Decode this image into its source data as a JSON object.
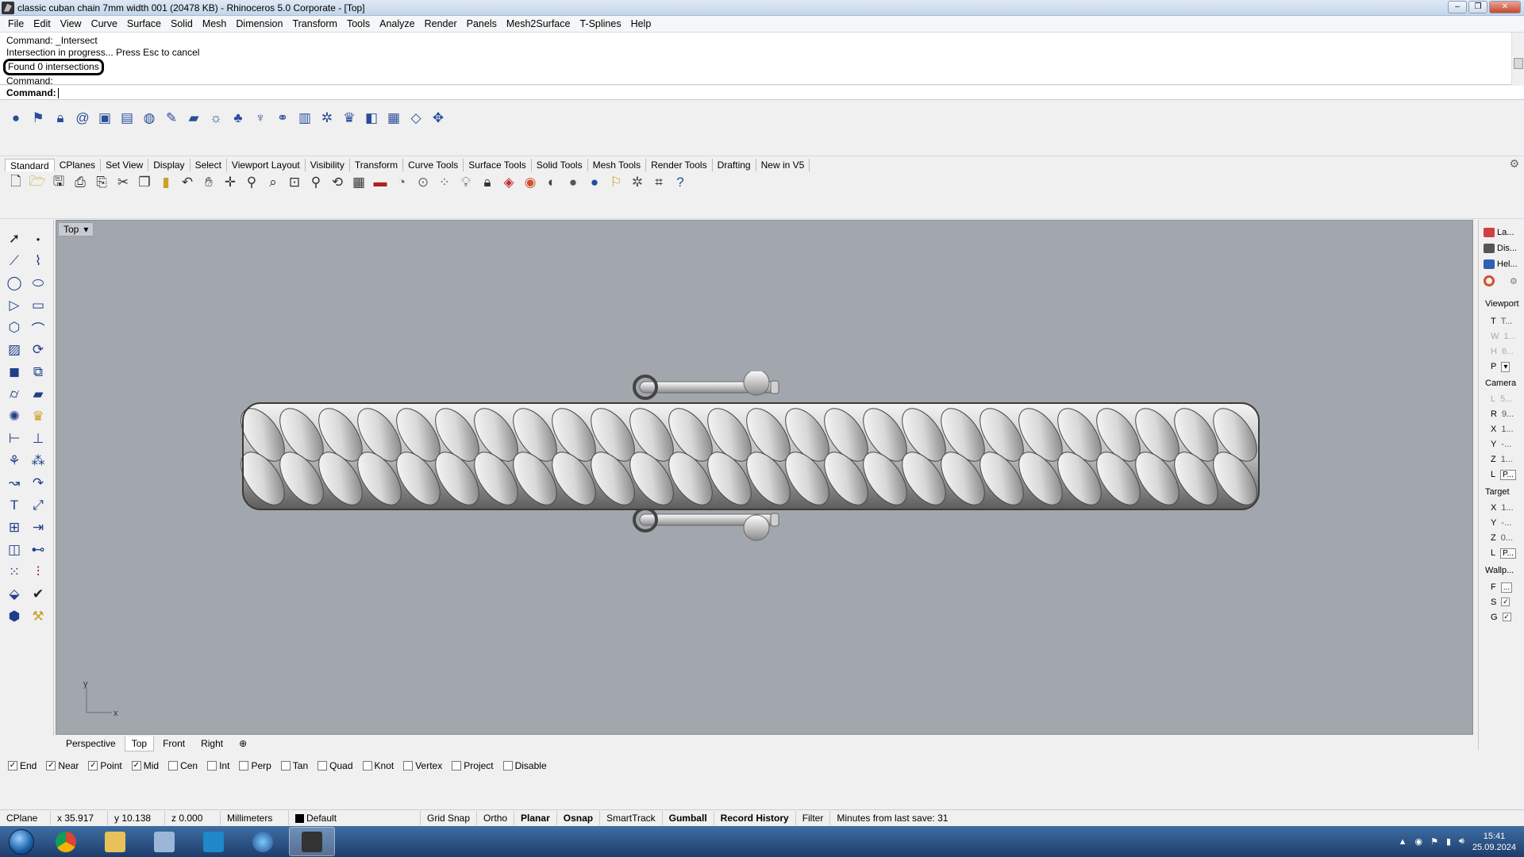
{
  "window": {
    "title": "classic cuban chain 7mm width 001 (20478 KB) - Rhinoceros  5.0 Corporate - [Top]"
  },
  "menu": [
    "File",
    "Edit",
    "View",
    "Curve",
    "Surface",
    "Solid",
    "Mesh",
    "Dimension",
    "Transform",
    "Tools",
    "Analyze",
    "Render",
    "Panels",
    "Mesh2Surface",
    "T-Splines",
    "Help"
  ],
  "command": {
    "history": [
      "Command: _Intersect",
      "Intersection in progress... Press Esc to cancel",
      "Found 0 intersections",
      "Command:"
    ],
    "prompt_label": "Command:"
  },
  "toolbar_tabs": [
    "Standard",
    "CPlanes",
    "Set View",
    "Display",
    "Select",
    "Viewport Layout",
    "Visibility",
    "Transform",
    "Curve Tools",
    "Surface Tools",
    "Solid Tools",
    "Mesh Tools",
    "Render Tools",
    "Drafting",
    "New in V5"
  ],
  "viewport": {
    "name": "Top",
    "axis_x": "x",
    "axis_y": "y",
    "tabs": [
      "Perspective",
      "Top",
      "Front",
      "Right"
    ],
    "active_tab": "Top"
  },
  "right_panel": {
    "panel_tabs": [
      "La...",
      "Dis...",
      "Hel..."
    ],
    "viewport_section": "Viewport",
    "viewport_rows": [
      {
        "k": "T",
        "v": "T..."
      },
      {
        "k": "W",
        "v": "1..."
      },
      {
        "k": "H",
        "v": "6..."
      },
      {
        "k": "P",
        "v": "▾"
      }
    ],
    "camera_section": "Camera",
    "camera_rows": [
      {
        "k": "L",
        "v": "5..."
      },
      {
        "k": "R",
        "v": "9..."
      },
      {
        "k": "X",
        "v": "1..."
      },
      {
        "k": "Y",
        "v": "-..."
      },
      {
        "k": "Z",
        "v": "1..."
      },
      {
        "k": "L",
        "v": "P..."
      }
    ],
    "target_section": "Target",
    "target_rows": [
      {
        "k": "X",
        "v": "1..."
      },
      {
        "k": "Y",
        "v": "-..."
      },
      {
        "k": "Z",
        "v": "0..."
      },
      {
        "k": "L",
        "v": "P..."
      }
    ],
    "wallpaper_section": "Wallp...",
    "wallpaper_rows": [
      {
        "k": "F",
        "v": "..."
      },
      {
        "k": "S",
        "v": "✓"
      },
      {
        "k": "G",
        "v": "✓"
      }
    ]
  },
  "osnap": [
    {
      "label": "End",
      "checked": true
    },
    {
      "label": "Near",
      "checked": true
    },
    {
      "label": "Point",
      "checked": true
    },
    {
      "label": "Mid",
      "checked": true
    },
    {
      "label": "Cen",
      "checked": false
    },
    {
      "label": "Int",
      "checked": false
    },
    {
      "label": "Perp",
      "checked": false
    },
    {
      "label": "Tan",
      "checked": false
    },
    {
      "label": "Quad",
      "checked": false
    },
    {
      "label": "Knot",
      "checked": false
    },
    {
      "label": "Vertex",
      "checked": false
    },
    {
      "label": "Project",
      "checked": false
    },
    {
      "label": "Disable",
      "checked": false
    }
  ],
  "status": {
    "cplane": "CPlane",
    "x": "x 35.917",
    "y": "y 10.138",
    "z": "z 0.000",
    "units": "Millimeters",
    "layer": "Default",
    "grid_snap": "Grid Snap",
    "ortho": "Ortho",
    "planar": "Planar",
    "osnap": "Osnap",
    "smarttrack": "SmartTrack",
    "gumball": "Gumball",
    "record_history": "Record History",
    "filter": "Filter",
    "save_info": "Minutes from last save: 31"
  },
  "taskbar": {
    "time": "15:41",
    "date": "25.09.2024"
  },
  "colors": {
    "viewport_bg": "#a2a7ad",
    "taskbar": "#2a5185",
    "highlight_box": "#000000"
  }
}
